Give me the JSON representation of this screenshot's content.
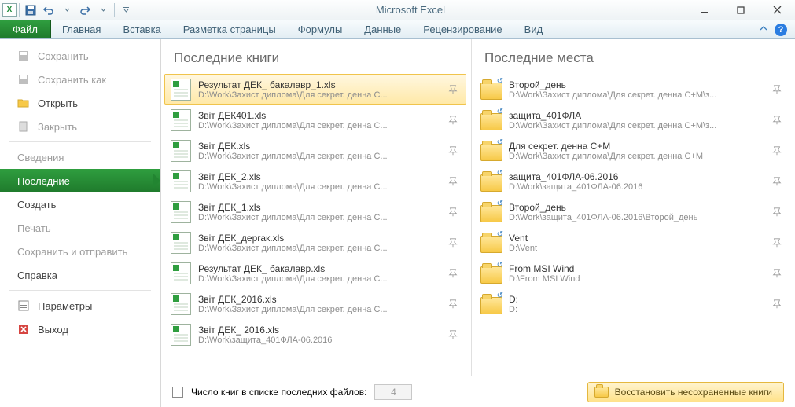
{
  "title": "Microsoft Excel",
  "tabs": {
    "file": "Файл",
    "list": [
      "Главная",
      "Вставка",
      "Разметка страницы",
      "Формулы",
      "Данные",
      "Рецензирование",
      "Вид"
    ]
  },
  "nav": {
    "save": "Сохранить",
    "save_as": "Сохранить как",
    "open": "Открыть",
    "close": "Закрыть",
    "info": "Сведения",
    "recent": "Последние",
    "new": "Создать",
    "print": "Печать",
    "share": "Сохранить и отправить",
    "help": "Справка",
    "options": "Параметры",
    "exit": "Выход"
  },
  "headings": {
    "books": "Последние книги",
    "places": "Последние места"
  },
  "books": [
    {
      "name": "Результат ДЕК_ бакалавр_1.xls",
      "path": "D:\\Work\\Захист диплома\\Для секрет. денна С..."
    },
    {
      "name": "Звіт ДЕК401.xls",
      "path": "D:\\Work\\Захист диплома\\Для секрет. денна С..."
    },
    {
      "name": "Звіт ДЕК.xls",
      "path": "D:\\Work\\Захист диплома\\Для секрет. денна С..."
    },
    {
      "name": "Звіт ДЕК_2.xls",
      "path": "D:\\Work\\Захист диплома\\Для секрет. денна С..."
    },
    {
      "name": "Звіт ДЕК_1.xls",
      "path": "D:\\Work\\Захист диплома\\Для секрет. денна С..."
    },
    {
      "name": "Звіт ДЕК_дергак.xls",
      "path": "D:\\Work\\Захист диплома\\Для секрет. денна С..."
    },
    {
      "name": "Результат ДЕК_ бакалавр.xls",
      "path": "D:\\Work\\Захист диплома\\Для секрет. денна С..."
    },
    {
      "name": "Звіт ДЕК_2016.xls",
      "path": "D:\\Work\\Захист диплома\\Для секрет. денна С..."
    },
    {
      "name": "Звіт ДЕК_ 2016.xls",
      "path": "D:\\Work\\защита_401ФЛА-06.2016"
    }
  ],
  "places": [
    {
      "name": "Второй_день",
      "path": "D:\\Work\\Захист диплома\\Для секрет. денна С+М\\з..."
    },
    {
      "name": "защита_401ФЛА",
      "path": "D:\\Work\\Захист диплома\\Для секрет. денна С+М\\з..."
    },
    {
      "name": "Для секрет. денна С+М",
      "path": "D:\\Work\\Захист диплома\\Для секрет. денна С+М"
    },
    {
      "name": "защита_401ФЛА-06.2016",
      "path": "D:\\Work\\защита_401ФЛА-06.2016"
    },
    {
      "name": "Второй_день",
      "path": "D:\\Work\\защита_401ФЛА-06.2016\\Второй_день"
    },
    {
      "name": "Vent",
      "path": "D:\\Vent"
    },
    {
      "name": "From MSI Wind",
      "path": "D:\\From MSI Wind"
    },
    {
      "name": "D:",
      "path": "D:"
    }
  ],
  "bottom": {
    "label": "Число книг в списке последних файлов:",
    "value": "4",
    "restore": "Восстановить несохраненные книги"
  }
}
